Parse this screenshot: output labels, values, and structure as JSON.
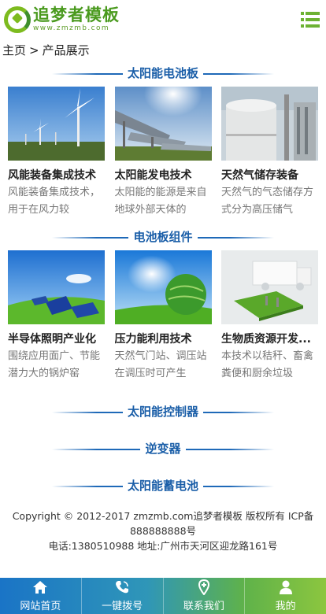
{
  "header": {
    "logo_title": "追梦者模板",
    "logo_sub": "www.zmzmb.com",
    "menu_icon": "menu-icon"
  },
  "breadcrumb": {
    "home": "主页",
    "separator": ">",
    "current": "产品展示"
  },
  "sections": [
    {
      "title": "太阳能电池板",
      "products": [
        {
          "title": "风能装备集成技术",
          "desc": "风能装备集成技术，用于在风力较"
        },
        {
          "title": "太阳能发电技术",
          "desc": "太阳能的能源是来自地球外部天体的"
        },
        {
          "title": "天然气储存装备",
          "desc": "天然气的气态储存方式分为高压储气"
        }
      ]
    },
    {
      "title": "电池板组件",
      "products": [
        {
          "title": "半导体照明产业化",
          "desc": "围绕应用面广、节能潜力大的锅炉窑"
        },
        {
          "title": "压力能利用技术",
          "desc": "天然气门站、调压站在调压时可产生"
        },
        {
          "title": "生物质资源开发...",
          "desc": "本技术以秸秆、畜禽粪便和厨余垃圾"
        }
      ]
    },
    {
      "title": "太阳能控制器"
    },
    {
      "title": "逆变器"
    },
    {
      "title": "太阳能蓄电池"
    }
  ],
  "footer": {
    "copyright": "Copyright © 2012-2017 zmzmb.com追梦者模板 版权所有  ICP备888888888号",
    "contact": "电话:1380510988  地址:广州市天河区迎龙路161号"
  },
  "bottom_nav": [
    {
      "label": "网站首页",
      "icon": "home-icon"
    },
    {
      "label": "一键拨号",
      "icon": "phone-icon"
    },
    {
      "label": "联系我们",
      "icon": "location-icon"
    },
    {
      "label": "我的",
      "icon": "user-icon"
    }
  ],
  "colors": {
    "brand_green": "#4a9a1e",
    "section_blue": "#1a5ea8",
    "nav_gradient_start": "#1a74c6",
    "nav_gradient_end": "#8cc63f"
  }
}
